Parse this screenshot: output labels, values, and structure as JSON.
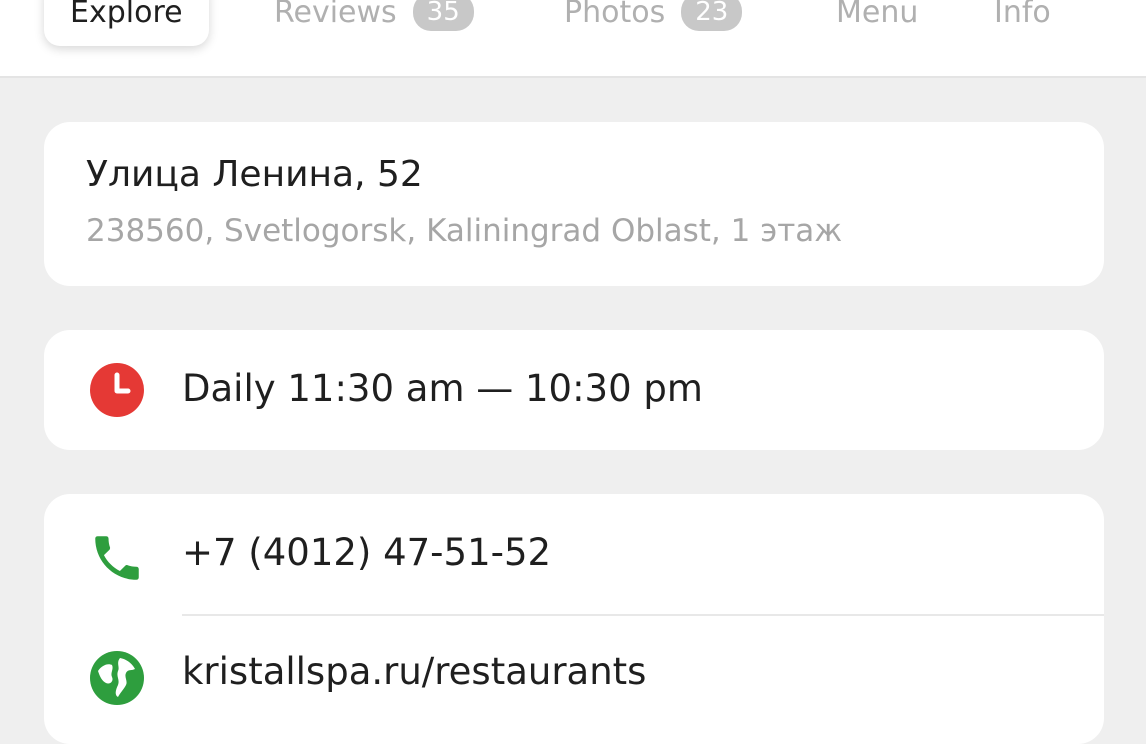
{
  "tabs": [
    {
      "label": "Explore",
      "active": true
    },
    {
      "label": "Reviews",
      "count": "35"
    },
    {
      "label": "Photos",
      "count": "23"
    },
    {
      "label": "Menu"
    },
    {
      "label": "Info"
    }
  ],
  "address": {
    "street": "Улица Ленина, 52",
    "details": "238560, Svetlogorsk, Kaliningrad Oblast, 1 этаж"
  },
  "hours": {
    "icon": "clock-icon",
    "icon_color": "#e53935",
    "text": "Daily 11:30 am — 10:30 pm"
  },
  "contacts": {
    "phone": {
      "icon": "phone-icon",
      "icon_color": "#2e9e3e",
      "text": "+7 (4012) 47-51-52"
    },
    "website": {
      "icon": "globe-icon",
      "icon_color": "#2e9e3e",
      "text": "kristallspa.ru/restaurants"
    }
  }
}
